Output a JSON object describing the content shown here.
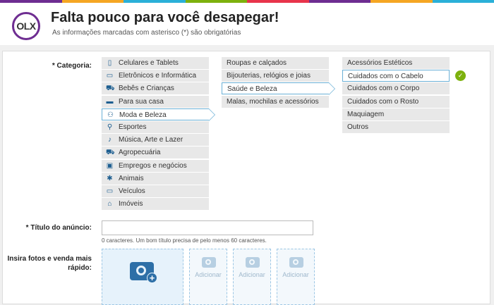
{
  "header": {
    "logo": "OLX",
    "title": "Falta pouco para você desapegar!",
    "subtitle": "As informações marcadas com asterisco (*) são obrigatórias"
  },
  "colors": {
    "bar": [
      "#6e2d91",
      "#f5a623",
      "#2ab0d8",
      "#7db10d",
      "#e8344b",
      "#6e2d91",
      "#f5a623",
      "#2ab0d8"
    ],
    "selected_border": "#6ab0d6",
    "icon": "#1d5e90"
  },
  "categoria": {
    "label": "* Categoria:",
    "col1": [
      {
        "label": "Celulares e Tablets",
        "icon": "phone-icon",
        "glyph": "▯"
      },
      {
        "label": "Eletrônicos e Informática",
        "icon": "monitor-icon",
        "glyph": "▭"
      },
      {
        "label": "Bebês e Crianças",
        "icon": "stroller-icon",
        "glyph": "⛟"
      },
      {
        "label": "Para sua casa",
        "icon": "sofa-icon",
        "glyph": "▬"
      },
      {
        "label": "Moda e Beleza",
        "icon": "people-icon",
        "glyph": "⚇"
      },
      {
        "label": "Esportes",
        "icon": "bicycle-icon",
        "glyph": "⚲"
      },
      {
        "label": "Música, Arte e Lazer",
        "icon": "guitar-icon",
        "glyph": "♪"
      },
      {
        "label": "Agropecuária",
        "icon": "tractor-icon",
        "glyph": "⛟"
      },
      {
        "label": "Empregos e negócios",
        "icon": "briefcase-icon",
        "glyph": "▣"
      },
      {
        "label": "Animais",
        "icon": "paw-icon",
        "glyph": "✱"
      },
      {
        "label": "Veículos",
        "icon": "car-icon",
        "glyph": "▭"
      },
      {
        "label": "Imóveis",
        "icon": "house-icon",
        "glyph": "⌂"
      }
    ],
    "col2": [
      {
        "label": "Roupas e calçados"
      },
      {
        "label": "Bijouterias, relógios e joias"
      },
      {
        "label": "Saúde e Beleza"
      },
      {
        "label": "Malas, mochilas e acessórios"
      }
    ],
    "col3": [
      {
        "label": "Acessórios Estéticos"
      },
      {
        "label": "Cuidados com o Cabelo"
      },
      {
        "label": "Cuidados com o Corpo"
      },
      {
        "label": "Cuidados com o Rosto"
      },
      {
        "label": "Maquiagem"
      },
      {
        "label": "Outros"
      }
    ],
    "selected": {
      "col1": 4,
      "col2": 2,
      "col3": 1
    }
  },
  "titulo": {
    "label": "* Título do anúncio:",
    "value": "",
    "hint": "0 caracteres. Um bom título precisa de pelo menos 60 caracteres."
  },
  "fotos": {
    "label_line1": "Insira fotos e venda mais",
    "label_line2": "rápido:",
    "add_label": "Adicionar"
  }
}
